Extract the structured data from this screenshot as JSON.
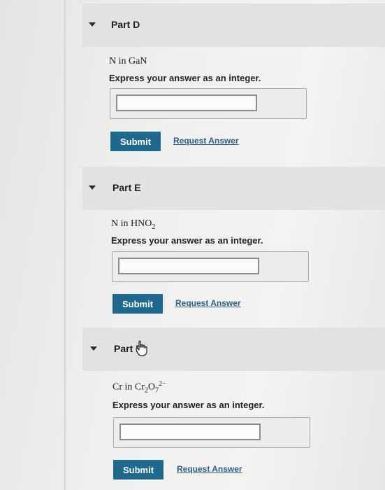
{
  "parts": [
    {
      "title": "Part D",
      "question": {
        "element": "N",
        "in": "in",
        "formula_main": "GaN"
      },
      "instruction": "Express your answer as an integer.",
      "submit_label": "Submit",
      "request_label": "Request Answer"
    },
    {
      "title": "Part E",
      "question": {
        "element": "N",
        "in": "in",
        "formula_main": "HNO",
        "formula_sub": "2"
      },
      "instruction": "Express your answer as an integer.",
      "submit_label": "Submit",
      "request_label": "Request Answer"
    },
    {
      "title": "Part F",
      "question": {
        "element": "Cr",
        "in": "in",
        "f1": "Cr",
        "f1_sub": "2",
        "f2": "O",
        "f2_sub": "7",
        "charge": "2−"
      },
      "instruction": "Express your answer as an integer.",
      "submit_label": "Submit",
      "request_label": "Request Answer"
    }
  ],
  "colors": {
    "submit_bg": "#1e6a8e",
    "link": "#2b5f84"
  },
  "icons": {
    "expand": "caret-down-icon",
    "pointer": "hand-pointer-icon"
  }
}
